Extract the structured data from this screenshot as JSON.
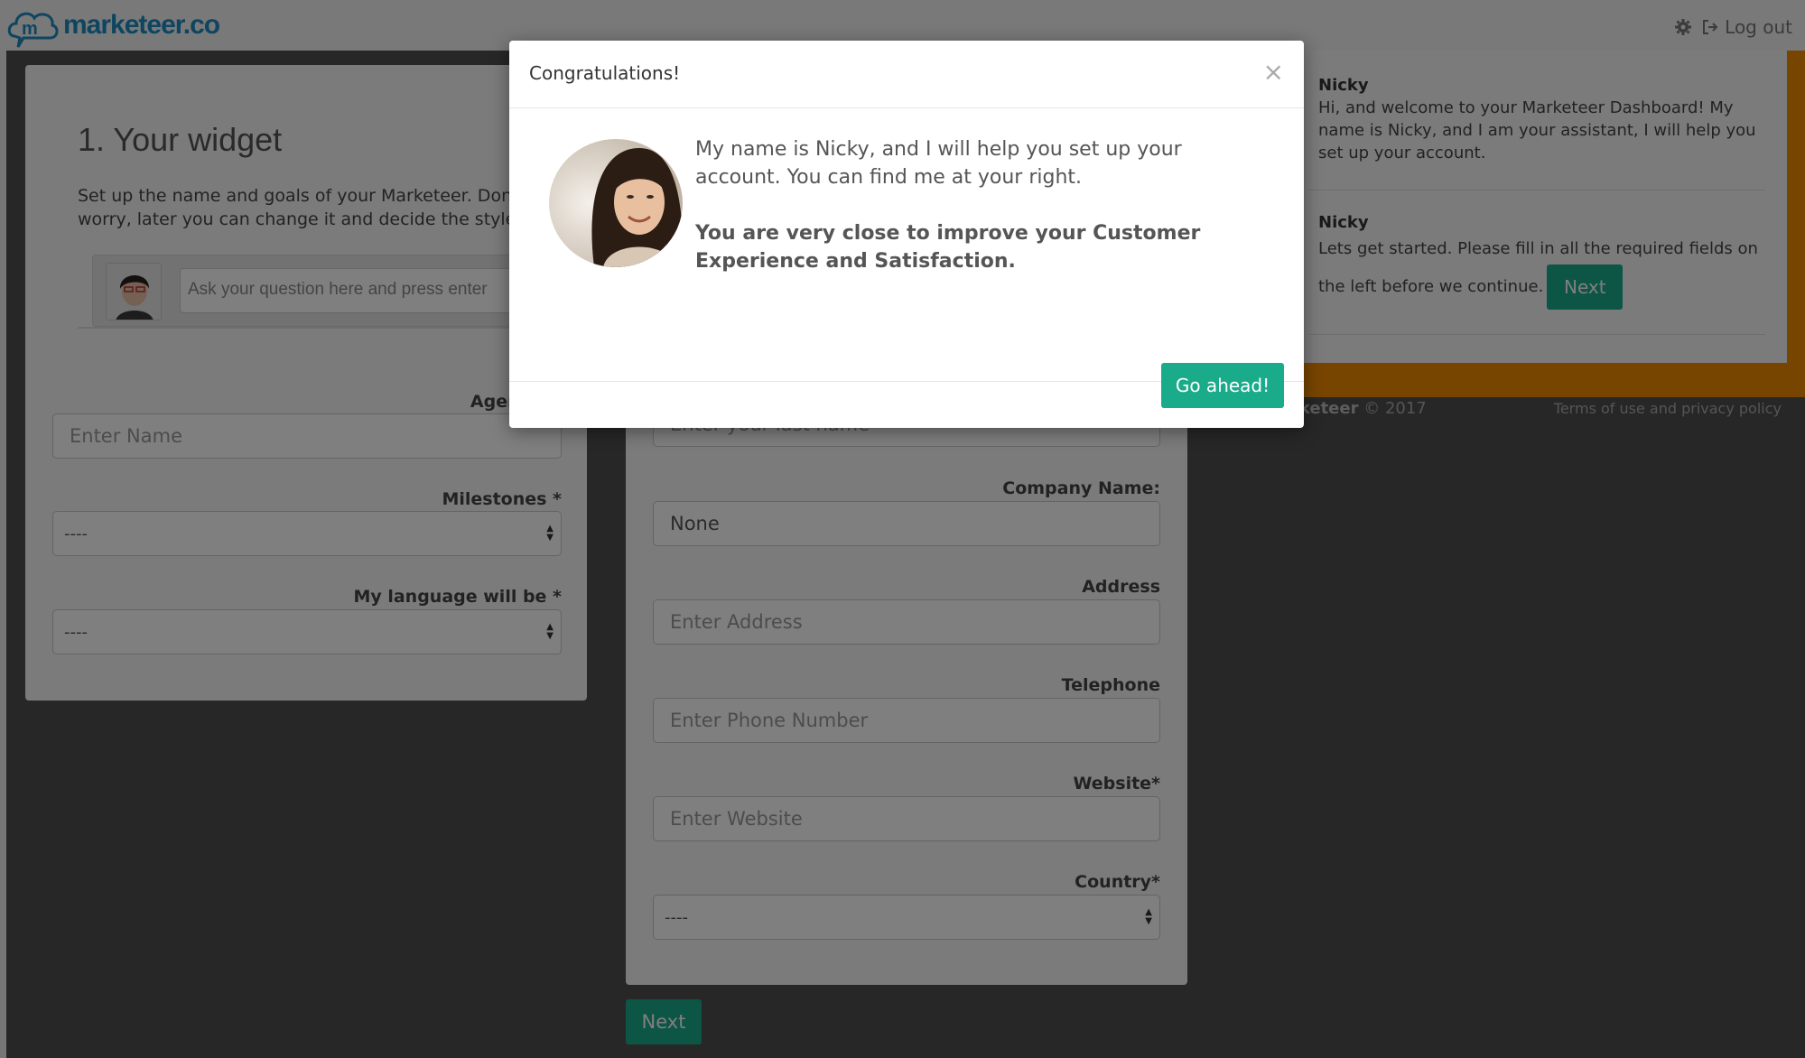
{
  "header": {
    "logo_text": "marketeer.co",
    "logout_label": "Log out",
    "settings_icon": "gear-icon",
    "logout_icon": "logout-icon"
  },
  "widget_panel": {
    "title": "1. Your widget",
    "description": "Set up the name and goals of your Marketeer. Don't worry, later you can change it and decide the style.",
    "preview_placeholder": "Ask your question here and press enter",
    "agent_name_label": "Agent's n",
    "agent_name_placeholder": "Enter Name",
    "milestones_label": "Milestones *",
    "milestones_value": "----",
    "language_label": "My language will be *",
    "language_value": "----"
  },
  "company_panel": {
    "last_name_placeholder": "Enter your last name",
    "company_label": "Company Name:",
    "company_value": "None",
    "address_label": "Address",
    "address_placeholder": "Enter Address",
    "telephone_label": "Telephone",
    "telephone_placeholder": "Enter Phone Number",
    "website_label": "Website*",
    "website_placeholder": "Enter Website",
    "country_label": "Country*",
    "country_value": "----",
    "next_label": "Next"
  },
  "assistant": {
    "messages": [
      {
        "name": "Nicky",
        "text": "Hi, and welcome to your Marketeer Dashboard! My name is Nicky, and I am your assistant, I will help you set up your account."
      },
      {
        "name": "Nicky",
        "text": "Lets get started. Please fill in all the required fields on the left before we continue."
      }
    ],
    "next_label": "Next"
  },
  "footer": {
    "brand": "rketeer",
    "copyright": "© 2017",
    "terms": "Terms of use and privacy policy"
  },
  "modal": {
    "title": "Congratulations!",
    "close": "×",
    "line1": "My name is Nicky, and I will help you set up your account. You can find me at your right.",
    "line2": "You are very close to improve your Customer Experience and Satisfaction.",
    "button": "Go ahead!"
  },
  "colors": {
    "accent": "#1aab8a",
    "brand": "#1d8bc1",
    "assistant_border": "#f08a00"
  }
}
